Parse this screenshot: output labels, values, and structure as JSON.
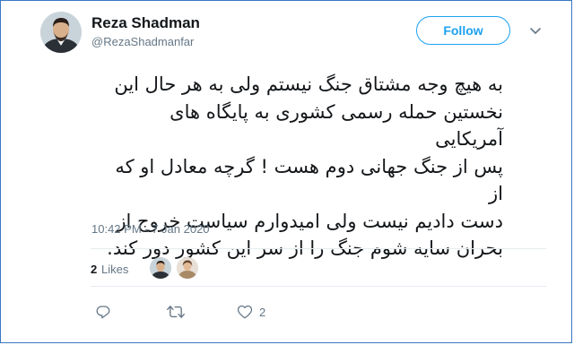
{
  "user": {
    "display_name": "Reza Shadman",
    "handle": "@RezaShadmanfar"
  },
  "follow_button": {
    "label": "Follow"
  },
  "tweet": {
    "text": "به هیچ وجه مشتاق جنگ نیستم ولی به هر حال این\nنخستین حمله رسمی کشوری به پایگاه های آمریکایی\nپس از جنگ جهانی دوم هست !  گرچه معادل او که از\nدست دادیم نیست ولی امیدوارم سیاست خروج از\nبحران سایه شوم جنگ را از سر این کشور دور کند.",
    "timestamp": "10:42 PM - 7 Jan 2020"
  },
  "likes": {
    "count": "2",
    "label": "Likes"
  },
  "actions": {
    "reply_icon": "reply-icon",
    "retweet_icon": "retweet-icon",
    "like_icon": "heart-icon",
    "like_count": "2"
  },
  "colors": {
    "accent": "#1da1f2",
    "secondary_text": "#657786",
    "primary_text": "#14171a",
    "divider": "#e6ecf0",
    "frame_border": "#3a78c2"
  }
}
